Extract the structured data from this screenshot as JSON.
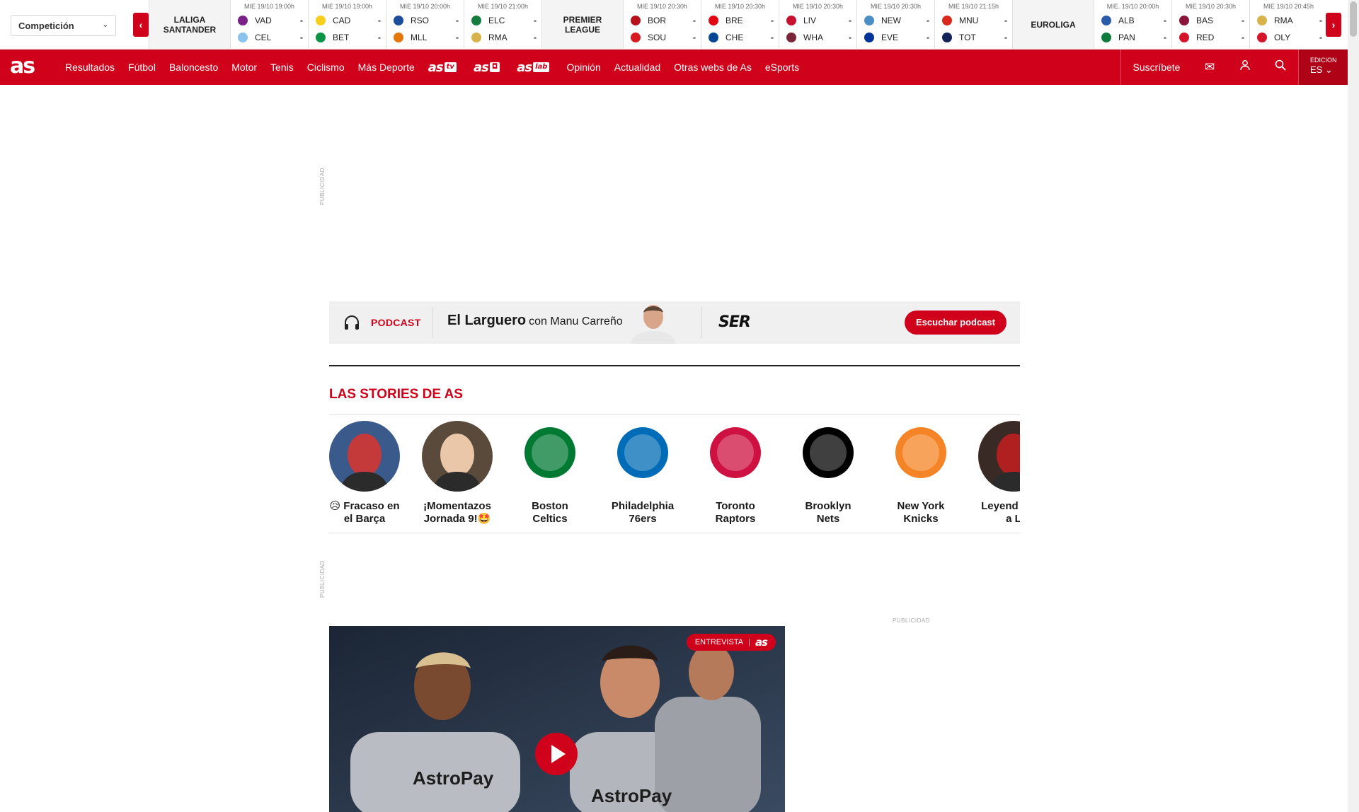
{
  "scoreboard": {
    "competition_select": "Competición",
    "prev_label": "‹",
    "next_label": "›",
    "groups": [
      {
        "league": "LALIGA\nSANTANDER",
        "matches": [
          {
            "date": "MIE 19/10 19:00h",
            "home": "VAD",
            "away": "CEL",
            "home_score": "-",
            "away_score": "-",
            "home_color": "#7b1f8a",
            "away_color": "#8ac3ee"
          },
          {
            "date": "MIE 19/10 19:00h",
            "home": "CAD",
            "away": "BET",
            "home_score": "-",
            "away_score": "-",
            "home_color": "#f6cf1c",
            "away_color": "#0b9444"
          },
          {
            "date": "MIE 19/10 20:00h",
            "home": "RSO",
            "away": "MLL",
            "home_score": "-",
            "away_score": "-",
            "home_color": "#1c4c9c",
            "away_color": "#e4760c"
          },
          {
            "date": "MIE 19/10 21:00h",
            "home": "ELC",
            "away": "RMA",
            "home_score": "-",
            "away_score": "-",
            "home_color": "#157b3f",
            "away_color": "#d8b24a"
          }
        ]
      },
      {
        "league": "PREMIER\nLEAGUE",
        "matches": [
          {
            "date": "MIE 19/10 20:30h",
            "home": "BOR",
            "away": "SOU",
            "home_score": "-",
            "away_score": "-",
            "home_color": "#b5121b",
            "away_color": "#d71920"
          },
          {
            "date": "MIE 19/10 20:30h",
            "home": "BRE",
            "away": "CHE",
            "home_score": "-",
            "away_score": "-",
            "home_color": "#e30613",
            "away_color": "#034694"
          },
          {
            "date": "MIE 19/10 20:30h",
            "home": "LIV",
            "away": "WHA",
            "home_score": "-",
            "away_score": "-",
            "home_color": "#c8102e",
            "away_color": "#7a263a"
          },
          {
            "date": "MIE 19/10 20:30h",
            "home": "NEW",
            "away": "EVE",
            "home_score": "-",
            "away_score": "-",
            "home_color": "#4a8ec6",
            "away_color": "#003399"
          },
          {
            "date": "MIE 19/10 21:15h",
            "home": "MNU",
            "away": "TOT",
            "home_score": "-",
            "away_score": "-",
            "home_color": "#da291c",
            "away_color": "#132257"
          }
        ]
      },
      {
        "league": "EUROLIGA",
        "matches": [
          {
            "date": "MIE. 19/10 20:00h",
            "home": "ALB",
            "away": "PAN",
            "home_score": "-",
            "away_score": "-",
            "home_color": "#2b5aa8",
            "away_color": "#0e7a3b"
          },
          {
            "date": "MIE 19/10 20:30h",
            "home": "BAS",
            "away": "RED",
            "home_score": "-",
            "away_score": "-",
            "home_color": "#8a1538",
            "away_color": "#d4142a"
          },
          {
            "date": "MIE 19/10 20:45h",
            "home": "RMA",
            "away": "OLY",
            "home_score": "-",
            "away_score": "-",
            "home_color": "#d8b24a",
            "away_color": "#d4142a"
          }
        ]
      }
    ]
  },
  "nav": {
    "logo": "as",
    "items": [
      "Resultados",
      "Fútbol",
      "Baloncesto",
      "Motor",
      "Tenis",
      "Ciclismo",
      "Más Deporte"
    ],
    "brands": [
      {
        "name": "as",
        "tag": "tv"
      },
      {
        "name": "as",
        "tag": "◘"
      },
      {
        "name": "as",
        "tag": "lab"
      }
    ],
    "items2": [
      "Opinión",
      "Actualidad",
      "Otras webs de As",
      "eSports"
    ],
    "subscribe": "Suscríbete",
    "mail_icon": "✉",
    "user_icon": "⚲",
    "search_icon": "⌕",
    "edition_label": "EDICION",
    "edition_value": "ES ⌄"
  },
  "ads": {
    "label": "PUBLICIDAD"
  },
  "podcast": {
    "label": "PODCAST",
    "title": "El Larguero",
    "with": "con Manu Carreño",
    "brand": "SER",
    "button": "Escuchar podcast"
  },
  "stories": {
    "title": "LAS STORIES DE AS",
    "items": [
      {
        "label": "😥 Fracaso en el Barça",
        "bg": "#3b5a8c",
        "accent": "#c43a3a"
      },
      {
        "label": "¡Momentazos Jornada 9!🤩",
        "bg": "#5a4a3c",
        "accent": "#e9c7a8"
      },
      {
        "label": "Boston Celtics",
        "bg": "#ffffff",
        "accent": "#007a33"
      },
      {
        "label": "Philadelphia 76ers",
        "bg": "#ffffff",
        "accent": "#006bb6"
      },
      {
        "label": "Toronto Raptors",
        "bg": "#ffffff",
        "accent": "#ce1141"
      },
      {
        "label": "Brooklyn Nets",
        "bg": "#ffffff",
        "accent": "#000000"
      },
      {
        "label": "New York Knicks",
        "bg": "#ffffff",
        "accent": "#f58426"
      },
      {
        "label": "Leyend mate a L",
        "bg": "#3a2a26",
        "accent": "#b02020"
      }
    ]
  },
  "video": {
    "badge": "ENTREVISTA",
    "badge_brand": "as",
    "sponsor_text": "AstroPay"
  }
}
